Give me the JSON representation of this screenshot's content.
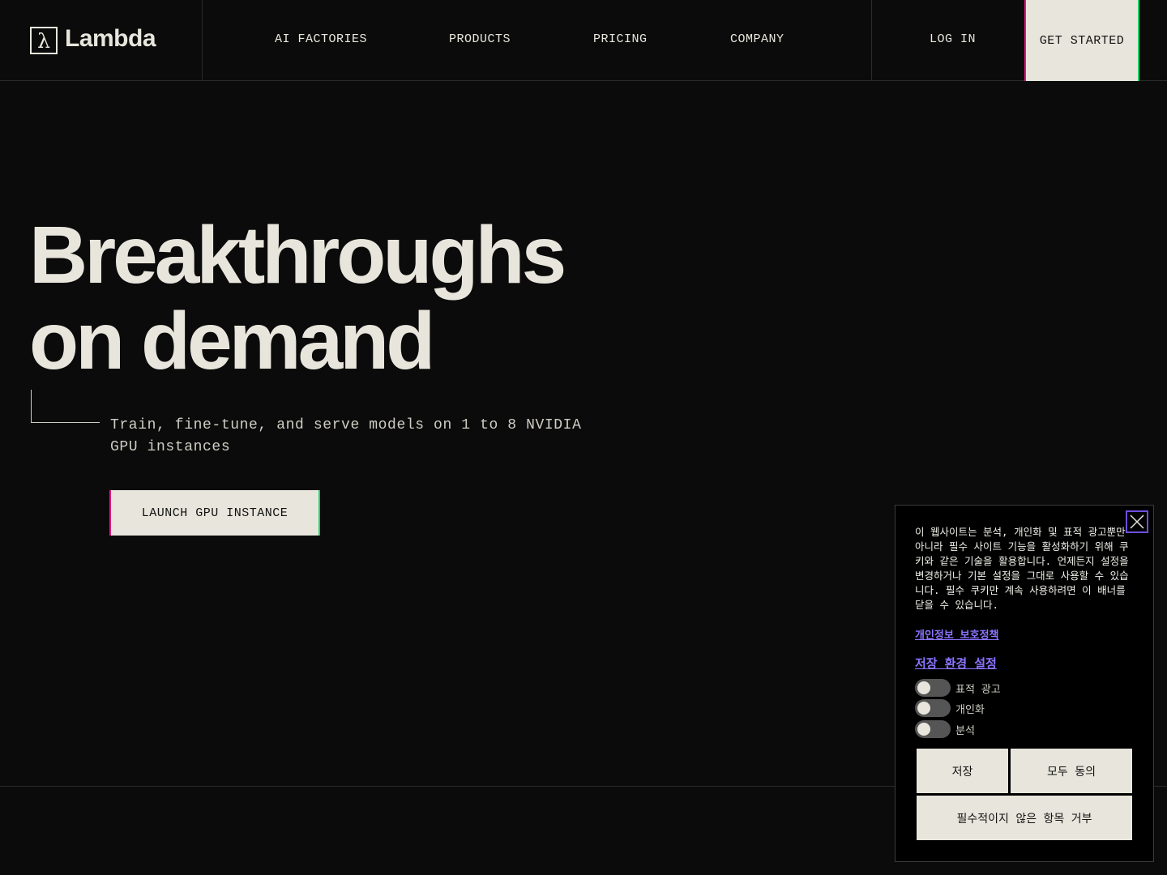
{
  "brand": {
    "name": "Lambda",
    "mark": "λ"
  },
  "nav": {
    "items": [
      "AI FACTORIES",
      "PRODUCTS",
      "PRICING",
      "COMPANY"
    ],
    "login": "LOG IN",
    "get_started": "GET STARTED"
  },
  "hero": {
    "title_line1": "Breakthroughs",
    "title_line2": "on demand",
    "subtitle": "Train, fine-tune, and serve models on 1 to 8 NVIDIA GPU instances",
    "cta": "LAUNCH GPU INSTANCE"
  },
  "cookie_banner": {
    "text": "이 웹사이트는 분석, 개인화 및 표적 광고뿐만 아니라 필수 사이트 기능을 활성화하기 위해 쿠키와 같은 기술을 활용합니다. 언제든지 설정을 변경하거나 기본 설정을 그대로 사용할 수 있습니다. 필수 쿠키만 계속 사용하려면 이 배너를 닫을 수 있습니다.",
    "privacy_link": "개인정보 보호정책",
    "preferences_title": "저장 환경 설정",
    "toggles": [
      {
        "label": "표적 광고",
        "on": false
      },
      {
        "label": "개인화",
        "on": false
      },
      {
        "label": "분석",
        "on": false
      }
    ],
    "save_button": "저장",
    "accept_all_button": "모두 동의",
    "reject_button": "필수적이지 않은 항목 거부"
  }
}
